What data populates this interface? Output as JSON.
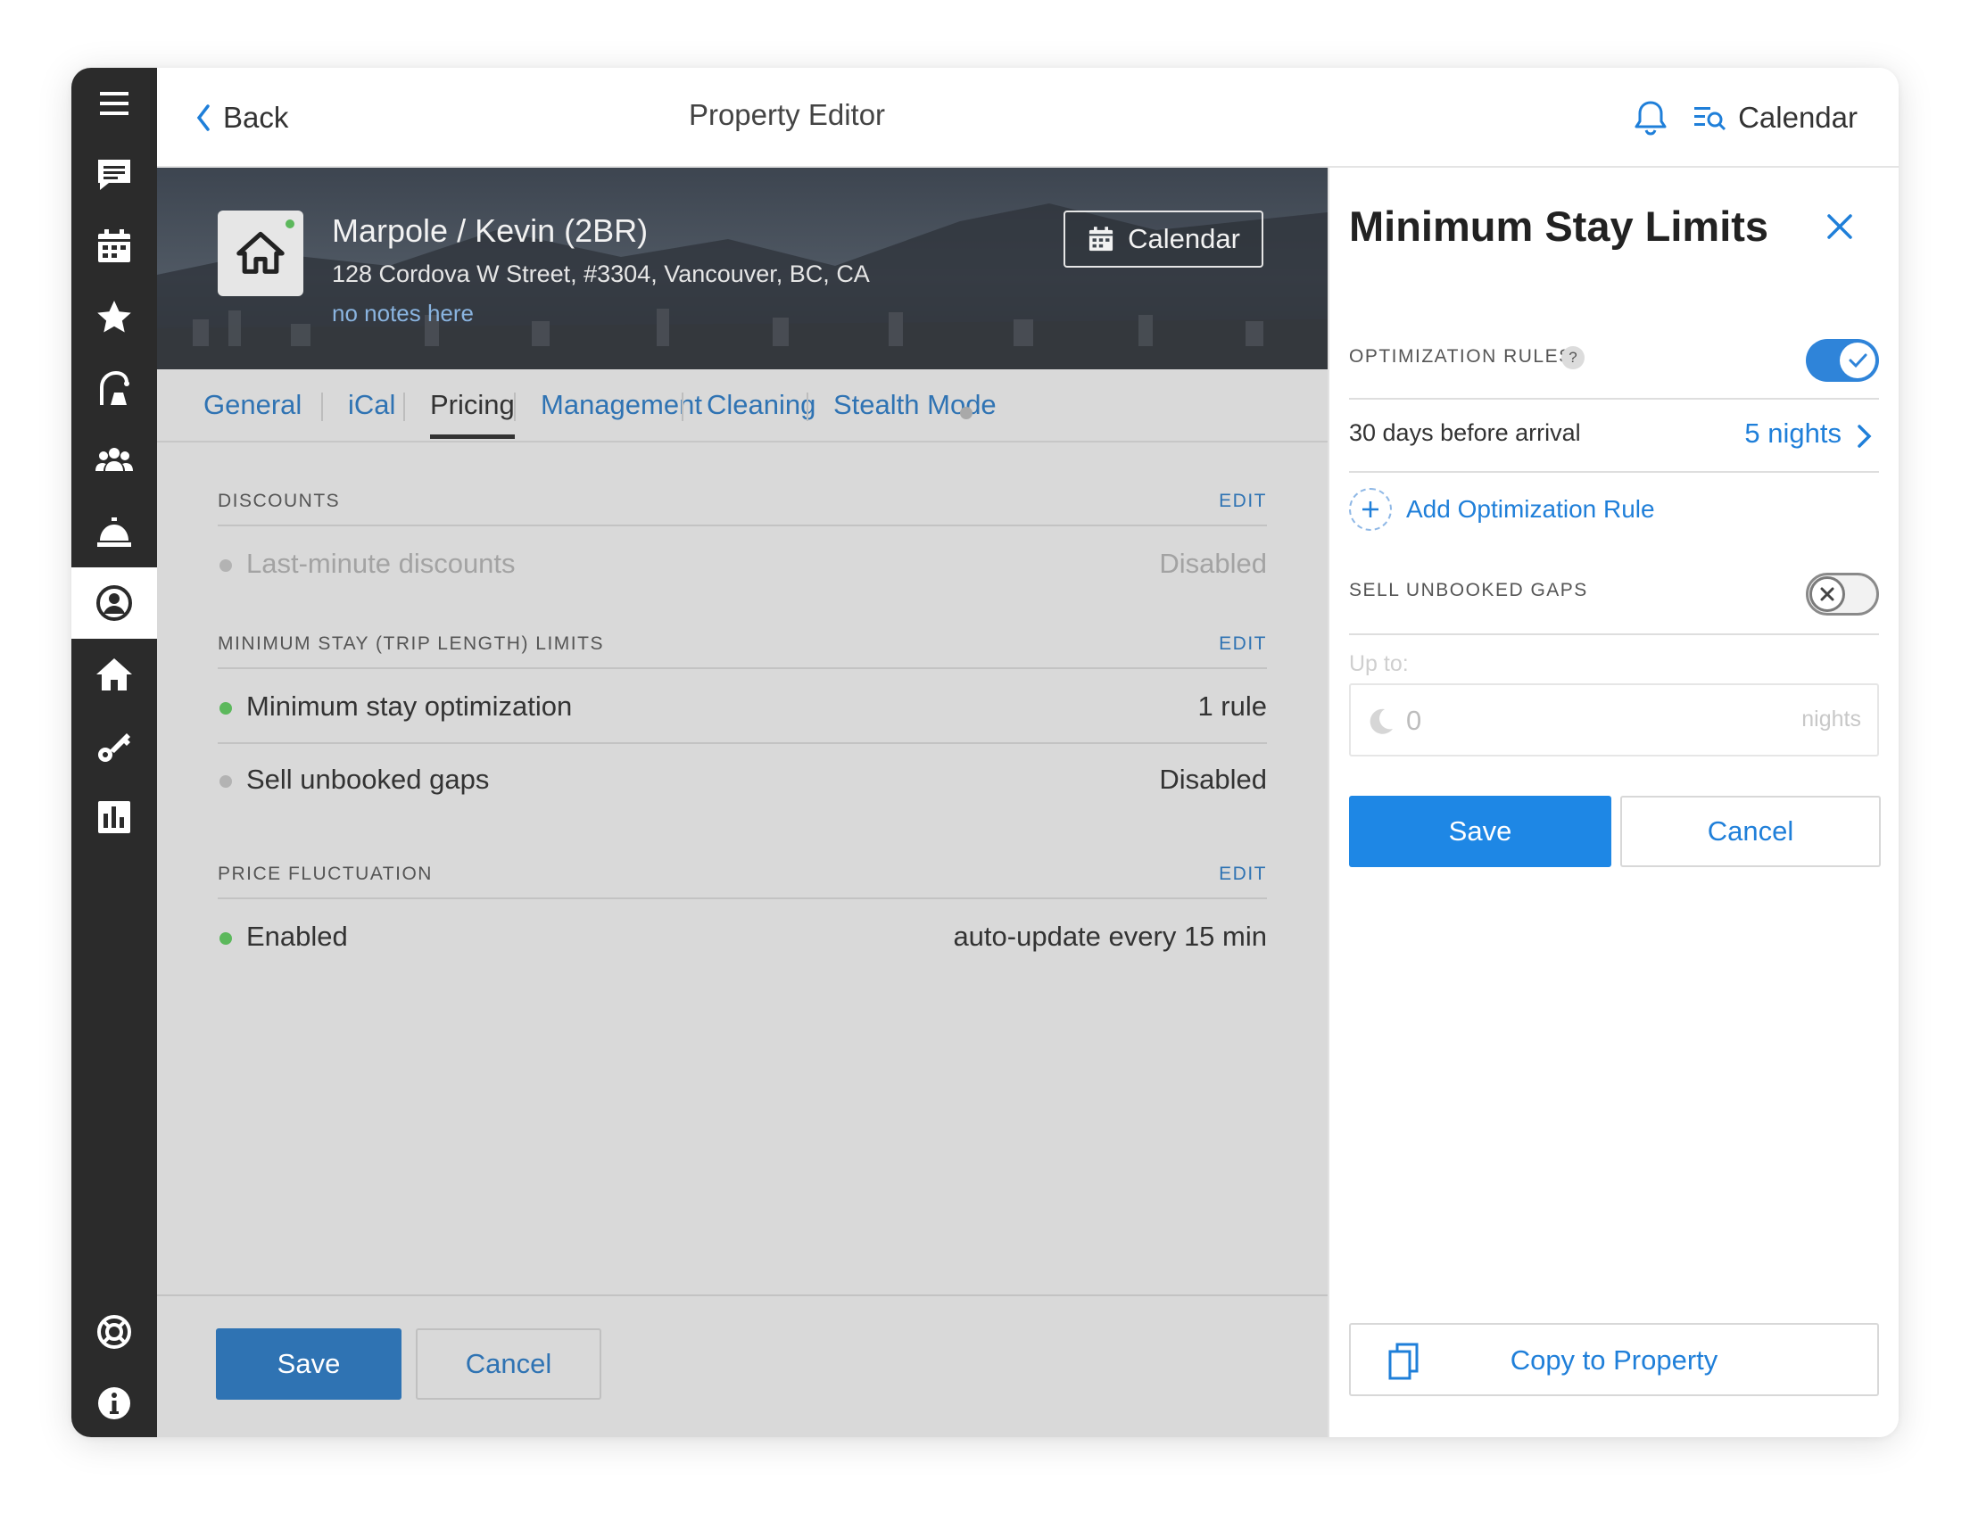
{
  "topbar": {
    "back_label": "Back",
    "title": "Property Editor",
    "calendar_label": "Calendar"
  },
  "property": {
    "name": "Marpole / Kevin (2BR)",
    "address": "128 Cordova W Street, #3304, Vancouver, BC, CA",
    "notes": "no notes here",
    "calendar_button": "Calendar"
  },
  "tabs": [
    {
      "label": "General"
    },
    {
      "label": "iCal"
    },
    {
      "label": "Pricing",
      "active": true
    },
    {
      "label": "Management"
    },
    {
      "label": "Cleaning"
    },
    {
      "label": "Stealth Mode"
    }
  ],
  "sections": {
    "discounts": {
      "label": "DISCOUNTS",
      "edit": "EDIT",
      "rows": [
        {
          "name": "Last-minute discounts",
          "value": "Disabled",
          "status": "disabled"
        }
      ]
    },
    "min_stay": {
      "label": "MINIMUM STAY (TRIP LENGTH) LIMITS",
      "edit": "EDIT",
      "rows": [
        {
          "name": "Minimum stay optimization",
          "value": "1 rule",
          "status": "enabled"
        },
        {
          "name": "Sell unbooked gaps",
          "value": "Disabled",
          "status": "disabled"
        }
      ]
    },
    "price_fluctuation": {
      "label": "PRICE FLUCTUATION",
      "edit": "EDIT",
      "rows": [
        {
          "name": "Enabled",
          "value": "auto-update every 15 min",
          "status": "enabled"
        }
      ]
    }
  },
  "main_footer": {
    "save_label": "Save",
    "cancel_label": "Cancel"
  },
  "panel": {
    "title": "Minimum Stay Limits",
    "optimization_rules_label": "OPTIMIZATION RULES",
    "help_glyph": "?",
    "optimization_rules_on": true,
    "rule": {
      "label": "30 days before arrival",
      "value": "5 nights"
    },
    "add_rule_label": "Add Optimization Rule",
    "sell_gaps_label": "SELL UNBOOKED GAPS",
    "sell_gaps_on": false,
    "upto_label": "Up to:",
    "nights_value": "0",
    "nights_unit": "nights",
    "save_label": "Save",
    "cancel_label": "Cancel",
    "copy_label": "Copy to Property"
  },
  "colors": {
    "accent": "#2f73b3",
    "panel_accent": "#1f7fd9",
    "sidebar": "#2b2b2b",
    "enabled_dot": "#5cb85c",
    "disabled_dot": "#a9a9a9"
  },
  "sidebar_icons": [
    "menu-icon",
    "messages-icon",
    "calendar-icon",
    "star-icon",
    "cleaning-icon",
    "team-icon",
    "concierge-bell-icon",
    "user-circle-icon",
    "home-icon",
    "key-icon",
    "chart-icon",
    "lifebuoy-icon",
    "info-icon"
  ]
}
